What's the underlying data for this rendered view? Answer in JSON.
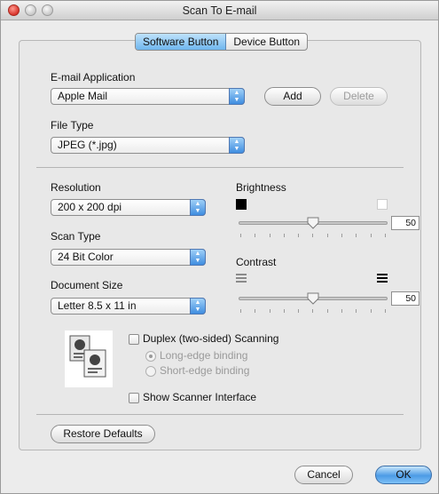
{
  "window": {
    "title": "Scan To E-mail"
  },
  "tabs": [
    {
      "label": "Software Button",
      "selected": true
    },
    {
      "label": "Device Button",
      "selected": false
    }
  ],
  "email_application": {
    "label": "E-mail Application",
    "value": "Apple Mail"
  },
  "buttons": {
    "add": "Add",
    "delete": "Delete",
    "restore_defaults": "Restore Defaults",
    "cancel": "Cancel",
    "ok": "OK"
  },
  "file_type": {
    "label": "File Type",
    "value": "JPEG (*.jpg)"
  },
  "resolution": {
    "label": "Resolution",
    "value": "200 x 200 dpi"
  },
  "scan_type": {
    "label": "Scan Type",
    "value": "24 Bit Color"
  },
  "document_size": {
    "label": "Document Size",
    "value": "Letter  8.5 x 11 in"
  },
  "brightness": {
    "label": "Brightness",
    "value": "50",
    "level": 0.5
  },
  "contrast": {
    "label": "Contrast",
    "value": "50",
    "level": 0.5
  },
  "duplex": {
    "label": "Duplex (two-sided) Scanning",
    "checked": false,
    "options": [
      {
        "label": "Long-edge binding",
        "selected": true
      },
      {
        "label": "Short-edge binding",
        "selected": false
      }
    ]
  },
  "show_scanner_interface": {
    "label": "Show Scanner Interface",
    "checked": false
  },
  "colors": {
    "accent": "#4c9be6",
    "close": "#d8332b"
  }
}
